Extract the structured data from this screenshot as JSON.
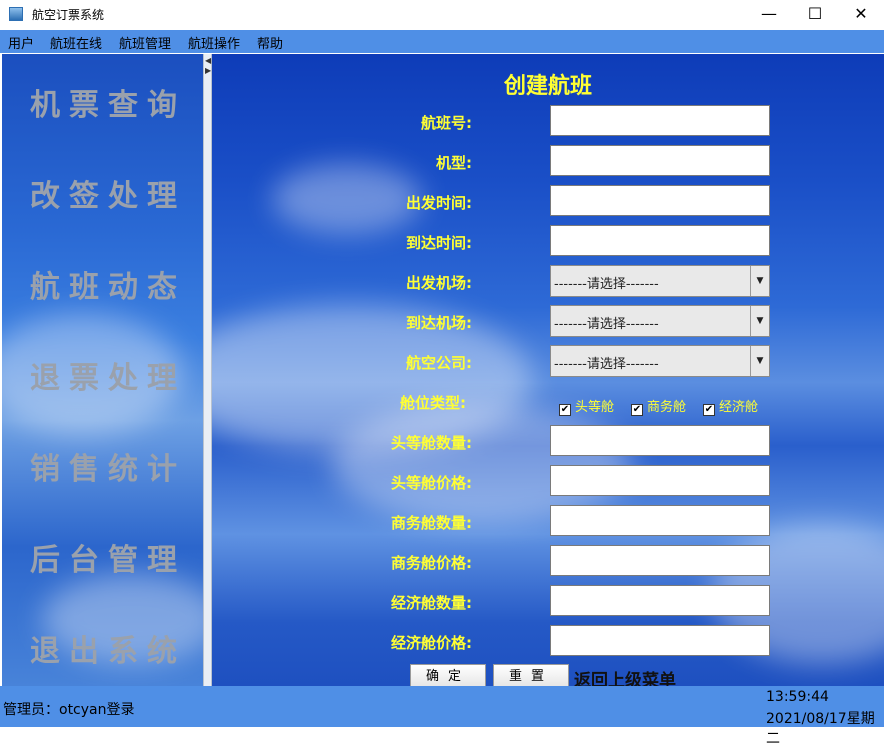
{
  "window": {
    "title": "航空订票系统",
    "minimize": "—",
    "maximize": "☐",
    "close": "✕"
  },
  "menu": [
    "用户",
    "航班在线",
    "航班管理",
    "航班操作",
    "帮助"
  ],
  "sidebar": [
    "机票查询",
    "改签处理",
    "航班动态",
    "退票处理",
    "销售统计",
    "后台管理",
    "退出系统"
  ],
  "form": {
    "title": "创建航班",
    "fields": {
      "flight_no": {
        "label": "航班号:",
        "value": ""
      },
      "model": {
        "label": "机型:",
        "value": ""
      },
      "depart_time": {
        "label": "出发时间:",
        "value": ""
      },
      "arrive_time": {
        "label": "到达时间:",
        "value": ""
      },
      "depart_airport": {
        "label": "出发机场:",
        "value": "-------请选择-------"
      },
      "arrive_airport": {
        "label": "到达机场:",
        "value": "-------请选择-------"
      },
      "airline": {
        "label": "航空公司:",
        "value": "-------请选择-------"
      },
      "cabin_type": {
        "label": "舱位类型:"
      },
      "first_qty": {
        "label": "头等舱数量:",
        "value": ""
      },
      "first_price": {
        "label": "头等舱价格:",
        "value": ""
      },
      "business_qty": {
        "label": "商务舱数量:",
        "value": ""
      },
      "business_price": {
        "label": "商务舱价格:",
        "value": ""
      },
      "economy_qty": {
        "label": "经济舱数量:",
        "value": ""
      },
      "economy_price": {
        "label": "经济舱价格:",
        "value": ""
      }
    },
    "cabins": [
      {
        "label": "头等舱",
        "checked": true
      },
      {
        "label": "商务舱",
        "checked": true
      },
      {
        "label": "经济舱",
        "checked": true
      }
    ],
    "confirm": "确定",
    "reset": "重置",
    "back": "返回上级菜单"
  },
  "status": {
    "user": "管理员：otcyan登录",
    "time": "13:59:44",
    "date": "2021/08/17星期二"
  },
  "colors": {
    "menubar": "#4f8fe6",
    "label": "#ffff33",
    "sidebar_text": "#9aa1ac"
  }
}
